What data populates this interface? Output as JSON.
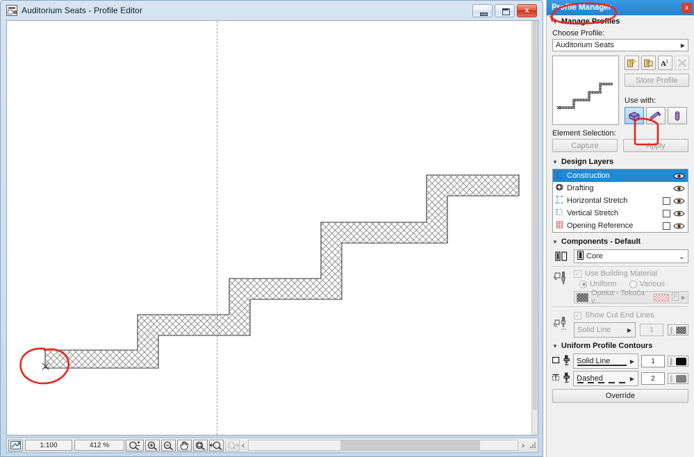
{
  "editor_window": {
    "title": "Auditorium Seats - Profile Editor",
    "app_icon": "profile-editor-icon",
    "buttons": {
      "minimize": "minimize-icon",
      "maximize": "maximize-icon",
      "close": "x"
    }
  },
  "statusbar": {
    "fit_icon": "fit-to-window-icon",
    "scale": "1:100",
    "zoom": "412 %",
    "tools": [
      {
        "name": "zoom-in-out-icon",
        "glyph": "⊕"
      },
      {
        "name": "zoom-in-icon",
        "glyph": "⊕"
      },
      {
        "name": "zoom-out-icon",
        "glyph": "⊖"
      },
      {
        "name": "pan-hand-icon",
        "glyph": "✋"
      },
      {
        "name": "fit-in-window-icon",
        "glyph": "⦿"
      },
      {
        "name": "previous-zoom-icon",
        "glyph": "←"
      },
      {
        "name": "next-zoom-icon",
        "glyph": "→"
      }
    ],
    "scroll_left_arrow": "‹",
    "scroll_right_arrow": "›",
    "resize_grip": "resize-grip-icon"
  },
  "canvas": {
    "vertical_guide": "dashed-vertical-guide",
    "origin_marker": "x",
    "shape_name": "auditorium-seats-stair-profile",
    "annotations": [
      {
        "name": "red-circle-origin",
        "shape": "ellipse"
      },
      {
        "name": "red-circle-profile-manager-title",
        "shape": "ellipse"
      },
      {
        "name": "red-rect-use-with-wall",
        "shape": "rectangle"
      }
    ]
  },
  "profile_manager": {
    "title": "Profile Manager",
    "close_label": "x",
    "manage_profiles": {
      "section_title": "Manage Profiles",
      "choose_profile_label": "Choose Profile:",
      "selected_profile": "Auditorium Seats",
      "dropdown_arrow": "▶",
      "preview_name": "profile-preview-stairs",
      "toolbar": [
        {
          "name": "new-profile-icon",
          "label": "New Profile"
        },
        {
          "name": "duplicate-profile-icon",
          "label": "Duplicate Profile"
        },
        {
          "name": "rename-profile-icon",
          "label": "Rename Profile"
        },
        {
          "name": "delete-profile-icon",
          "label": "Delete Profile"
        }
      ],
      "store_profile_label": "Store Profile",
      "use_with_label": "Use with:",
      "use_with": [
        {
          "name": "use-with-wall-icon",
          "label": "Wall",
          "selected": true
        },
        {
          "name": "use-with-beam-icon",
          "label": "Beam",
          "selected": false
        },
        {
          "name": "use-with-column-icon",
          "label": "Column",
          "selected": false
        }
      ],
      "element_selection_label": "Element Selection:",
      "capture_label": "Capture",
      "apply_label": "Apply"
    },
    "design_layers": {
      "section_title": "Design Layers",
      "rows": [
        {
          "icon": "construction-layer-icon",
          "label": "Construction",
          "selected": true,
          "checkbox": false,
          "visible": true
        },
        {
          "icon": "drafting-layer-icon",
          "label": "Drafting",
          "selected": false,
          "checkbox": false,
          "visible": true
        },
        {
          "icon": "horizontal-stretch-layer-icon",
          "label": "Horizontal Stretch",
          "selected": false,
          "checkbox": true,
          "visible": true
        },
        {
          "icon": "vertical-stretch-layer-icon",
          "label": "Vertical Stretch",
          "selected": false,
          "checkbox": true,
          "visible": true
        },
        {
          "icon": "opening-reference-layer-icon",
          "label": "Opening Reference",
          "selected": false,
          "checkbox": true,
          "visible": true
        }
      ]
    },
    "components": {
      "section_title": "Components - Default",
      "component_icon": "component-pair-icon",
      "component_selected": "Core",
      "component_item_icon": "core-icon",
      "dropdown_arrow": "⌄",
      "fill_icon": "fill-brush-icon",
      "use_building_material_label": "Use Building Material",
      "use_building_material_checked": true,
      "uniform_label": "Uniform",
      "various_label": "Various",
      "uniform_selected": true,
      "material_name": "Opeka - Tekoča v...",
      "material_swatch": "brick-texture-swatch",
      "material_fill_swatch": "pink-hatch-swatch",
      "material_more_icon": "▶",
      "show_cut_end_lines_label": "Show Cut End Lines",
      "show_cut_end_lines_checked": true,
      "cut_end_pen_icon": "cut-end-pen-icon",
      "cut_end_line_type": "Solid Line",
      "cut_end_pen_number": "1",
      "cut_end_pen_color": "#808080"
    },
    "uniform_profile_contours": {
      "section_title": "Uniform Profile Contours",
      "rows": [
        {
          "icon": "outer-contour-icon",
          "pen_icon": "pen-icon",
          "line_type": "Solid Line",
          "line_style": "solid",
          "pen_number": "1",
          "pen_color": "#0d0d0d"
        },
        {
          "icon": "inner-contour-icon",
          "pen_icon": "pen-icon",
          "line_type": "Dashed",
          "line_style": "dashed",
          "pen_number": "2",
          "pen_color": "#808080"
        }
      ],
      "override_label": "Override"
    }
  }
}
